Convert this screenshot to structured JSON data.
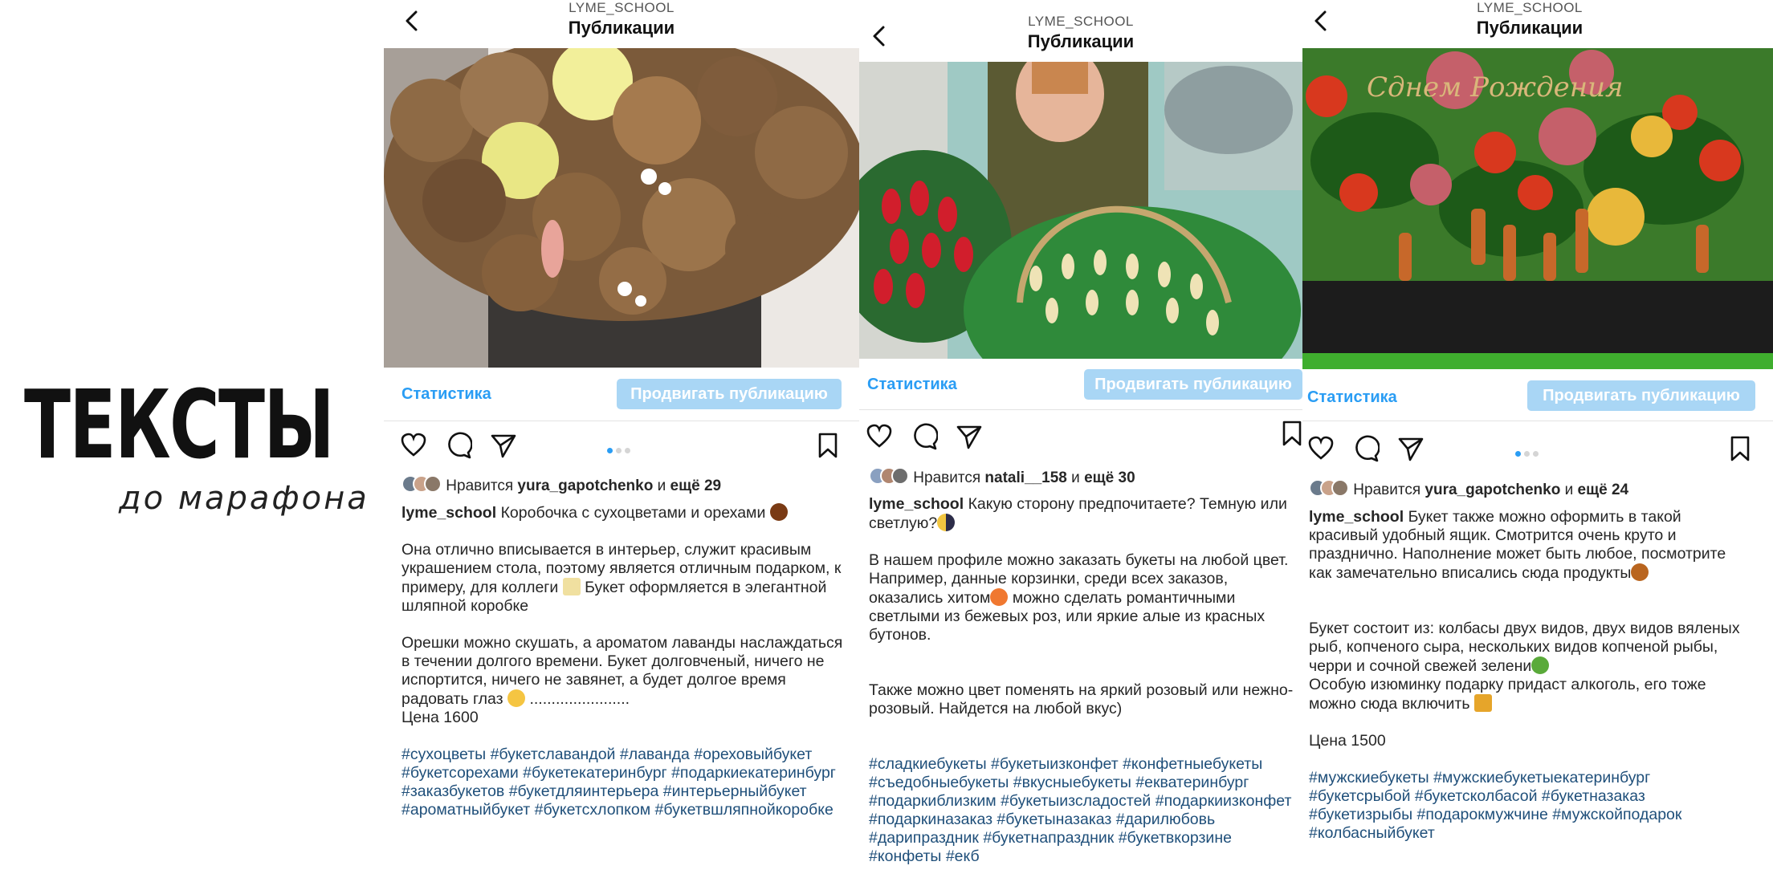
{
  "title": {
    "main": "ТЕКСТЫ",
    "sub": "до марафона"
  },
  "colors": {
    "link_blue": "#2a9df4",
    "promote_button": "#a9d6f5",
    "hashtag": "#1f4f7a"
  },
  "posts": [
    {
      "username_header": "LYME_SCHOOL",
      "header_title": "Публикации",
      "photo_description": "nuts-and-dried-flowers-bouquet-photo",
      "stats_label": "Статистика",
      "promote_label": "Продвигать публикацию",
      "likes_prefix": "Нравится",
      "likes_user": "yura_gapotchenko",
      "likes_and": "и",
      "likes_more": "ещё 29",
      "caption_user": "lyme_school",
      "caption_first": "Коробочка с сухоцветами и орехами",
      "paragraphs": [
        "Она отлично вписывается в интерьер, служит красивым украшением стола, поэтому является отличным подарком, к примеру, для коллеги",
        "Букет оформляется в элегантной шляпной коробке",
        "Орешки можно скушать, а ароматом лаванды наслаждаться в течении долгого времени. Букет долговченый, ничего не испортится, ничего не завянет, а будет долгое время радовать глаз",
        ".......................",
        "Цена 1600"
      ],
      "hashtags": "#сухоцветы #букетславандой #лаванда #ореховыйбукет #букетсорехами #букетекатеринбург #подаркиекатеринбург #заказбукетов #букетдляинтерьера #интерьерныйбукет #ароматныйбукет #букетсхлопком #букетвшляпнойкоробке"
    },
    {
      "username_header": "LYME_SCHOOL",
      "header_title": "Публикации",
      "photo_description": "woman-with-candy-bouquet-basket-photo",
      "stats_label": "Статистика",
      "promote_label": "Продвигать публикацию",
      "likes_prefix": "Нравится",
      "likes_user": "natali__158",
      "likes_and": "и",
      "likes_more": "ещё 30",
      "caption_user": "lyme_school",
      "caption_first": "Какую сторону предпочитаете? Темную или светлую?",
      "paragraphs": [
        "В нашем профиле можно заказать букеты на любой цвет. Например, данные корзинки, среди всех заказов, оказались хитом",
        "можно сделать романтичными светлыми из бежевых роз, или яркие алые из красных бутонов.",
        "Также можно цвет поменять на яркий розовый или нежно-розовый. Найдется на любой вкус)"
      ],
      "hashtags": "#сладкиебукеты #букетыизконфет #конфетныебукеты #съедобныебукеты #вкусныебукеты #екватеринбург #подаркиблизким #букетыизсладостей #подаркиизконфет #подаркиназаказ #букетыназаказ #дарилюбовь #дарипраздник #букетнапраздник #букетвкорзине #конфеты #екб"
    },
    {
      "username_header": "LYME_SCHOOL",
      "header_title": "Публикации",
      "photo_description": "men-sausage-and-vegetables-bouquet-photo",
      "photo_sign": "Сднем Рождения",
      "stats_label": "Статистика",
      "promote_label": "Продвигать публикацию",
      "likes_prefix": "Нравится",
      "likes_user": "yura_gapotchenko",
      "likes_and": "и",
      "likes_more": "ещё 24",
      "caption_user": "lyme_school",
      "caption_first": "Букет также можно оформить в такой красивый удобный ящик. Смотрится очень круто и празднично. Наполнение может быть любое, посмотрите как замечательно вписались сюда продукты",
      "paragraphs": [
        "Букет состоит из: колбасы двух видов, двух видов вяленых рыб, копченого сыра, нескольких видов копченой рыбы, черри и сочной свежей зелени",
        "Особую изюминку подарку придаст алкоголь, его тоже можно сюда включить",
        "Цена 1500"
      ],
      "hashtags": "#мужскиебукеты #мужскиебукетыекатеринбург #букетсрыбой #букетсколбасой #букетназаказ #букетизрыбы #подарокмужчине #мужскойподарок #колбасныйбукет"
    }
  ]
}
